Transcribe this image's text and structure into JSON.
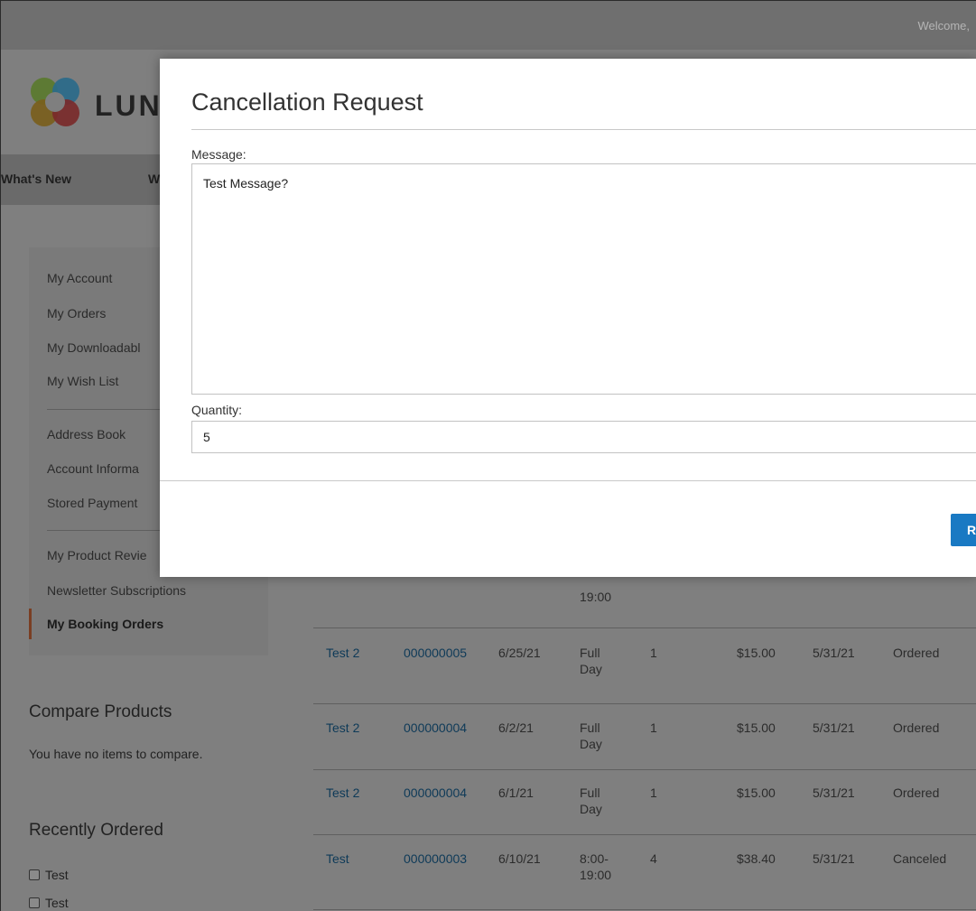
{
  "header": {
    "welcome": "Welcome,",
    "brand": "LUN",
    "logo_icon": "luma-logo-icon"
  },
  "nav": {
    "items": [
      "What's New",
      "W"
    ]
  },
  "sidebar": {
    "items": [
      "My Account",
      "My Orders",
      "My Downloadabl",
      "My Wish List",
      "Address Book",
      "Account Informa",
      "Stored Payment",
      "My Product Revie",
      "Newsletter Subscriptions"
    ],
    "current": "My Booking Orders"
  },
  "compare": {
    "title": "Compare Products",
    "empty_text": "You have no items to compare."
  },
  "recently_ordered": {
    "title": "Recently Ordered",
    "items": [
      "Test",
      "Test"
    ]
  },
  "orders": {
    "partial_row": {
      "time_line2": "19:00"
    },
    "rows": [
      {
        "name": "Test 2",
        "order": "000000005",
        "date": "6/25/21",
        "time_a": "Full",
        "time_b": "Day",
        "qty": "1",
        "price": "$15.00",
        "created": "5/31/21",
        "status": "Ordered"
      },
      {
        "name": "Test 2",
        "order": "000000004",
        "date": "6/2/21",
        "time_a": "Full",
        "time_b": "Day",
        "qty": "1",
        "price": "$15.00",
        "created": "5/31/21",
        "status": "Ordered"
      },
      {
        "name": "Test 2",
        "order": "000000004",
        "date": "6/1/21",
        "time_a": "Full",
        "time_b": "Day",
        "qty": "1",
        "price": "$15.00",
        "created": "5/31/21",
        "status": "Ordered"
      },
      {
        "name": "Test",
        "order": "000000003",
        "date": "6/10/21",
        "time_a": "8:00-",
        "time_b": "19:00",
        "qty": "4",
        "price": "$38.40",
        "created": "5/31/21",
        "status": "Canceled"
      }
    ]
  },
  "modal": {
    "title": "Cancellation Request",
    "message_label": "Message:",
    "message_value": "Test Message?",
    "quantity_label": "Quantity:",
    "quantity_value": "5",
    "submit_label": "R",
    "colors": {
      "primary_button": "#1979c3"
    }
  }
}
